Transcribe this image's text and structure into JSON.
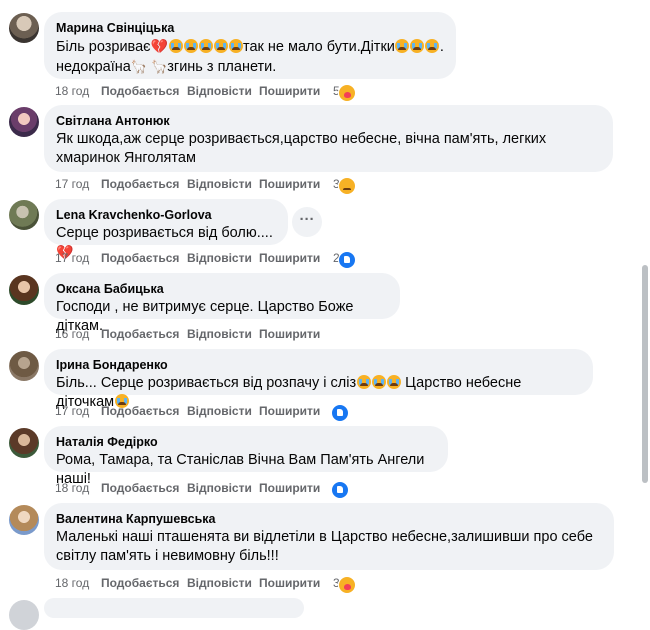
{
  "comments": [
    {
      "name": "Марина Свінціцька",
      "text_a": "Біль розриває",
      "text_b": "так не мало бути.Дітки",
      "text_c": ".",
      "text_d": "недокраїна",
      "text_e": "згинь з планети.",
      "time": "18 год",
      "like": "Подобається",
      "reply": "Відповісти",
      "share": "Поширити",
      "reaction_count": "5"
    },
    {
      "name": "Світлана Антонюк",
      "text": "Як шкода,аж серце розривається,царство небесне, вічна пам'ять, легких хмаринок Янголятам",
      "time": "17 год",
      "like": "Подобається",
      "reply": "Відповісти",
      "share": "Поширити",
      "reaction_count": "3"
    },
    {
      "name": "Lena Kravchenko-Gorlova",
      "text": "Серце розривається від болю....",
      "time": "17 год",
      "like": "Подобається",
      "reply": "Відповісти",
      "share": "Поширити",
      "reaction_count": "2"
    },
    {
      "name": "Оксана Бабицька",
      "text": "Господи , не витримує серце. Царство Боже діткам.",
      "time": "16 год",
      "like": "Подобається",
      "reply": "Відповісти",
      "share": "Поширити"
    },
    {
      "name": "Ірина Бондаренко",
      "text_a": "Біль... Серце розривається від розпачу і сліз",
      "text_b": "Царство небесне діточкам",
      "time": "17 год",
      "like": "Подобається",
      "reply": "Відповісти",
      "share": "Поширити"
    },
    {
      "name": "Наталія Федірко",
      "text": "Рома, Тамара, та Станіслав Вічна Вам Пам'ять Ангели наші!",
      "time": "18 год",
      "like": "Подобається",
      "reply": "Відповісти",
      "share": "Поширити"
    },
    {
      "name": "Валентина Карпушевська",
      "text": "Маленькі наші пташенята ви відлетіли в Царство небесне,залишивши про себе світлу пам'ять і невимовну біль!!!",
      "time": "18 год",
      "like": "Подобається",
      "reply": "Відповісти",
      "share": "Поширити",
      "reaction_count": "3"
    }
  ],
  "more_options_icon": "ellipsis-icon",
  "colors": {
    "bubble": "#f0f2f5",
    "meta_text": "#65676b",
    "like_blue": "#1877f2",
    "emoji_yellow": "#f7b125",
    "heart_red": "#e41e3f"
  }
}
